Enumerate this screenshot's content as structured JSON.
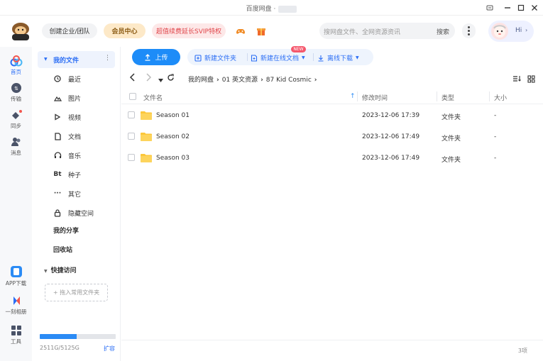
{
  "window": {
    "title": "百度网盘 ·"
  },
  "header": {
    "biz_label": "创建企业/团队",
    "vip_label": "会员中心",
    "promo_label": "超值续费延长SVIP特权",
    "search_placeholder": "搜网盘文件、全网资源资讯",
    "search_button": "搜索",
    "greeting": "Hi"
  },
  "rail": [
    {
      "label": "首页",
      "icon": "home-icon"
    },
    {
      "label": "传输",
      "icon": "transfer-icon"
    },
    {
      "label": "同步",
      "icon": "sync-icon"
    },
    {
      "label": "消息",
      "icon": "message-icon"
    },
    {
      "label": "APP下载",
      "icon": "app-download-icon"
    },
    {
      "label": "一刻相册",
      "icon": "album-icon"
    },
    {
      "label": "工具",
      "icon": "tools-icon"
    }
  ],
  "sidebar": {
    "my_files": "我的文件",
    "more": "⋮",
    "items": [
      {
        "label": "最近",
        "icon": "clock-icon"
      },
      {
        "label": "图片",
        "icon": "image-icon"
      },
      {
        "label": "视频",
        "icon": "video-icon"
      },
      {
        "label": "文档",
        "icon": "document-icon"
      },
      {
        "label": "音乐",
        "icon": "music-icon"
      },
      {
        "label": "种子",
        "icon": "bt-icon",
        "glyph": "Bt"
      },
      {
        "label": "其它",
        "icon": "more-icon",
        "glyph": "···"
      },
      {
        "label": "隐藏空间",
        "icon": "lock-icon"
      }
    ],
    "my_share": "我的分享",
    "recycle": "回收站",
    "quick_access": "快捷访问",
    "drop_hint": "+ 拖入常用文件夹",
    "quota_text": "2511G/5125G",
    "quota_fraction": 0.49,
    "expand": "扩容"
  },
  "toolbar": {
    "upload": "上传",
    "new_folder": "新建文件夹",
    "new_doc": "新建在线文档",
    "new_badge": "NEW",
    "offline_download": "离线下载"
  },
  "path": {
    "crumbs": [
      "我的网盘",
      "01 英文资源",
      "87 Kid Cosmic"
    ]
  },
  "table": {
    "headers": {
      "name": "文件名",
      "modified": "修改时间",
      "type": "类型",
      "size": "大小"
    },
    "rows": [
      {
        "name": "Season 01",
        "modified": "2023-12-06 17:39",
        "type": "文件夹",
        "size": "-"
      },
      {
        "name": "Season 02",
        "modified": "2023-12-06 17:49",
        "type": "文件夹",
        "size": "-"
      },
      {
        "name": "Season 03",
        "modified": "2023-12-06 17:49",
        "type": "文件夹",
        "size": "-"
      }
    ]
  },
  "footer": {
    "count": "3项"
  },
  "colors": {
    "accent": "#1d8cf8",
    "link": "#2b6ef5",
    "folder": "#fcc73a",
    "vip_bg": "#fde9c8",
    "promo_text": "#e0454a"
  }
}
